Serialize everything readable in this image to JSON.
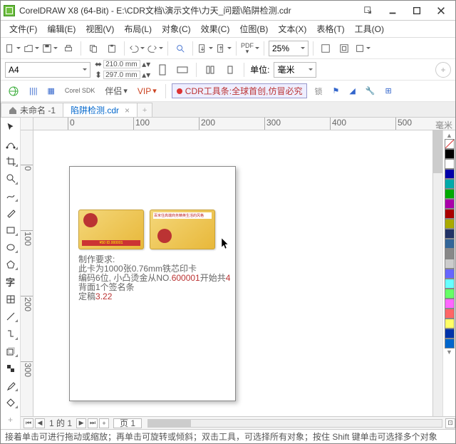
{
  "title": "CorelDRAW X8 (64-Bit) - E:\\CDR文档\\演示文件\\力天_问题\\陷阱检测.cdr",
  "menu": [
    "文件(F)",
    "编辑(E)",
    "视图(V)",
    "布局(L)",
    "对象(C)",
    "效果(C)",
    "位图(B)",
    "文本(X)",
    "表格(T)",
    "工具(O)"
  ],
  "zoom": "25%",
  "paper": "A4",
  "dims": {
    "w": "210.0 mm",
    "h": "297.0 mm"
  },
  "unitLabel": "单位:",
  "unitValue": "毫米",
  "plugins": {
    "earth": "",
    "bars": "",
    "qr": "",
    "sdk": "Corel SDK",
    "companion": "伴侣",
    "vip": "VIP",
    "cdr": "CDR工具条:全球首创,仿冒必究",
    "suo": "锁"
  },
  "tabs": [
    {
      "label": "未命名 -1"
    },
    {
      "label": "陷阱检测.cdr"
    }
  ],
  "ruler": {
    "h": [
      "0",
      "100",
      "200",
      "300",
      "400",
      "500",
      "毫米"
    ],
    "v": [
      "0",
      "100",
      "200",
      "300"
    ]
  },
  "card2top": "百米住高端商务精英生活的风格",
  "cardbar": "¥50  ID.000001",
  "notes": {
    "l1": "制作要求:",
    "l2a": "此卡为1000张0.76mm铁芯印卡",
    "l3a": "编码6位, 小凸烫金从NO.",
    "l3b": "600001",
    "l3c": "开始共",
    "l3d": "4",
    "l4": "背面1个签名条",
    "l5a": "定稿",
    "l5b": "3.22"
  },
  "pageNav": {
    "count": "1 的 1",
    "pgtab": "页 1"
  },
  "status": "接着单击可进行拖动或缩放；再单击可旋转或倾斜；双击工具，可选择所有对象；按住 Shift 键单击可选择多个对象",
  "palette": [
    "#000",
    "#fff",
    "#00a",
    "#0aa",
    "#0a0",
    "#a0a",
    "#a00",
    "#aa0",
    "#236",
    "#369",
    "#888",
    "#ccc",
    "#66f",
    "#6ff",
    "#6f6",
    "#f6f",
    "#f66",
    "#ff6",
    "#03a",
    "#06c"
  ]
}
